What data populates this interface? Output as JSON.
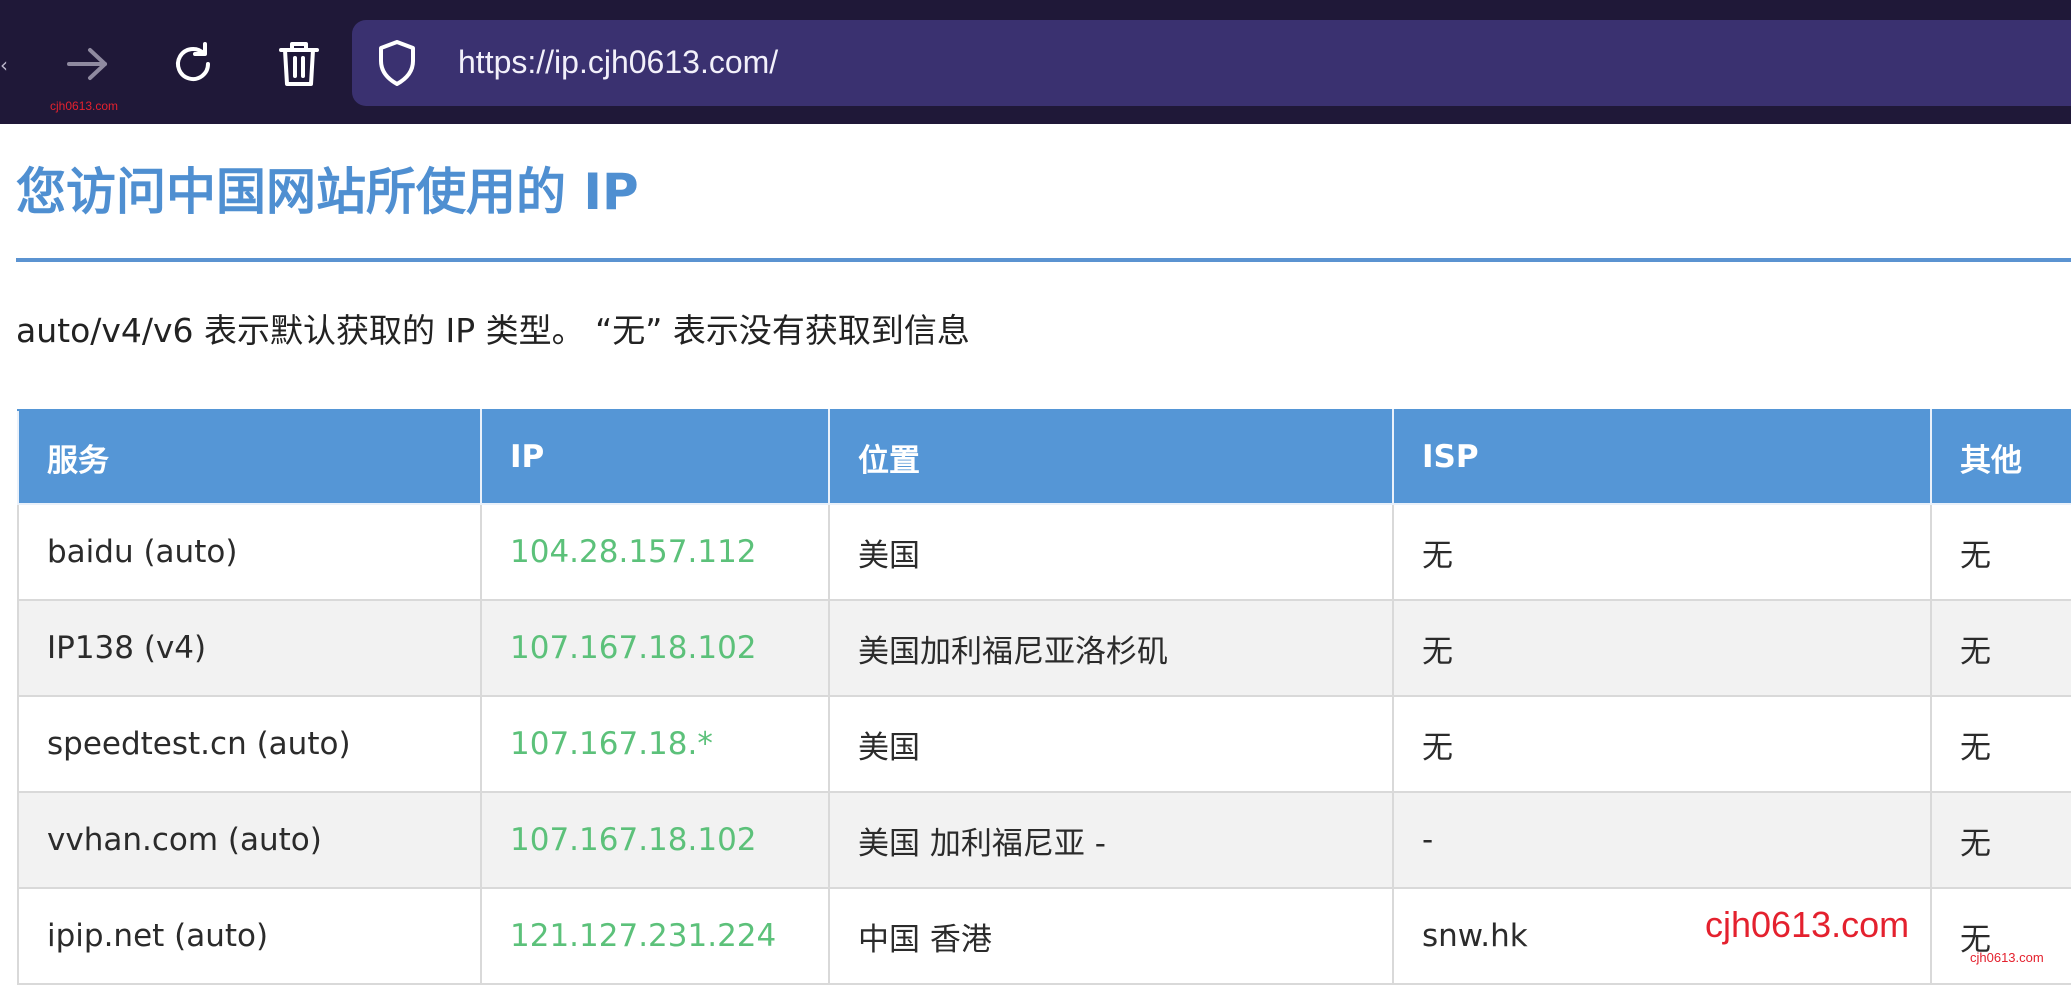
{
  "browser": {
    "url": "https://ip.cjh0613.com/",
    "watermark_small": "cjh0613.com"
  },
  "page": {
    "title": "您访问中国网站所使用的 IP",
    "description": "auto/v4/v6 表示默认获取的 IP 类型。 “无” 表示没有获取到信息"
  },
  "table": {
    "headers": [
      "服务",
      "IP",
      "位置",
      "ISP",
      "其他"
    ],
    "rows": [
      {
        "service": "baidu (auto)",
        "ip": "104.28.157.112",
        "location": "美国",
        "isp": "无",
        "other": "无"
      },
      {
        "service": "IP138 (v4)",
        "ip": "107.167.18.102",
        "location": "美国加利福尼亚洛杉矶",
        "isp": "无",
        "other": "无"
      },
      {
        "service": "speedtest.cn (auto)",
        "ip": "107.167.18.*",
        "location": "美国",
        "isp": "无",
        "other": "无"
      },
      {
        "service": "vvhan.com (auto)",
        "ip": "107.167.18.102",
        "location": "美国 加利福尼亚 -",
        "isp": "-",
        "other": "无"
      },
      {
        "service": "ipip.net (auto)",
        "ip": "121.127.231.224",
        "location": "中国 香港",
        "isp": "snw.hk",
        "other": "无"
      }
    ]
  },
  "watermark": {
    "large": "cjh0613.com",
    "small": "cjh0613.com"
  },
  "colors": {
    "toolbar_bg": "#1f1838",
    "urlbar_bg": "#3a3170",
    "heading": "#4f8fd1",
    "table_header_bg": "#5596d6",
    "ip_text": "#5cc17a",
    "watermark": "#e4212e"
  }
}
